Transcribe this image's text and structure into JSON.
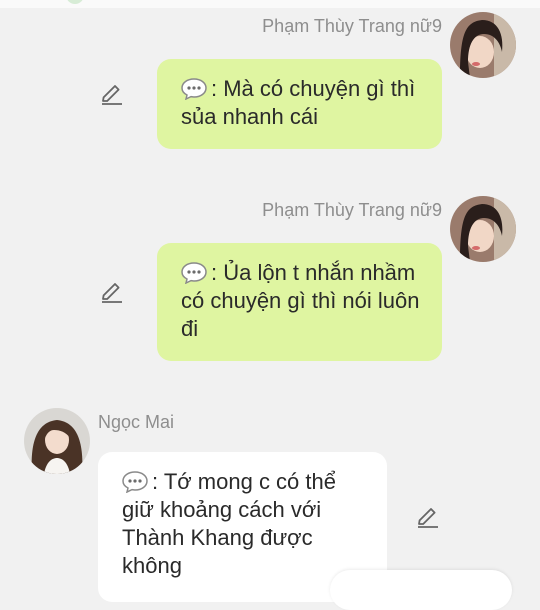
{
  "messages": [
    {
      "sender": "Phạm Thùy Trang nữ9",
      "direction": "outgoing",
      "text": ": Mà có chuyện gì thì sủa nhanh cái",
      "icon": "speech-bubble-icon"
    },
    {
      "sender": "Phạm Thùy Trang nữ9",
      "direction": "outgoing",
      "text": ": Ủa lộn t nhắn nhầm có chuyện gì thì nói luôn đi",
      "icon": "speech-bubble-icon"
    },
    {
      "sender": "Ngọc Mai",
      "direction": "incoming",
      "text": ": Tớ mong c có thể giữ khoảng cách với Thành Khang được không",
      "icon": "speech-bubble-icon"
    }
  ],
  "colors": {
    "background": "#f1f1f1",
    "outgoing_bubble": "#dff5a1",
    "incoming_bubble": "#ffffff",
    "sender_name": "#8e8e8e"
  }
}
